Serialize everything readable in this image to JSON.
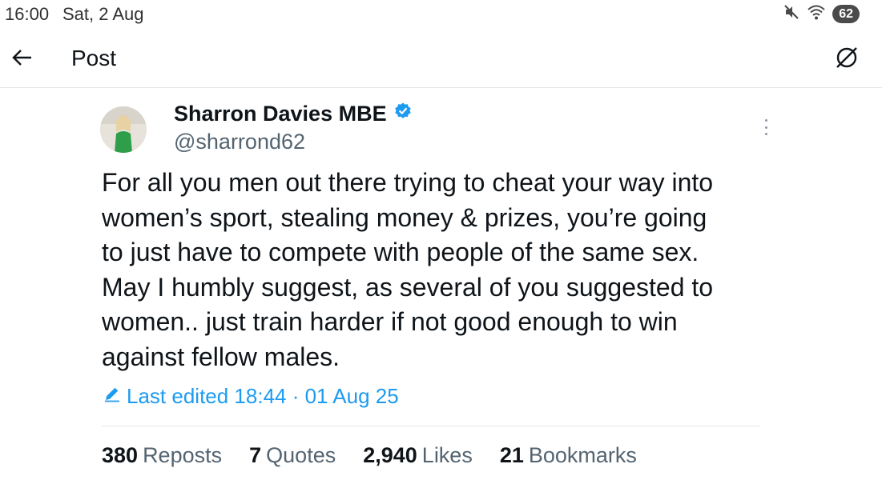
{
  "status_bar": {
    "time": "16:00",
    "date": "Sat, 2 Aug",
    "icons": [
      "mute-icon",
      "wifi-icon"
    ],
    "battery": "62"
  },
  "header": {
    "title": "Post",
    "back_icon": "arrow-left-icon",
    "grok_icon": "grok-icon"
  },
  "post": {
    "author_name": "Sharron Davies MBE",
    "verified": true,
    "handle": "@sharrond62",
    "text": "For all you men out there trying to cheat your way into\nwomen’s sport, stealing money & prizes, you’re going\nto just have to compete with people of the same sex.\nMay I humbly suggest, as several of you suggested to\nwomen..  just train harder if not good enough to win\nagainst fellow males.",
    "edited_label": "Last edited 18:44 · 01 Aug 25"
  },
  "stats": [
    {
      "count": "380",
      "label": "Reposts"
    },
    {
      "count": "7",
      "label": "Quotes"
    },
    {
      "count": "2,940",
      "label": "Likes"
    },
    {
      "count": "21",
      "label": "Bookmarks"
    }
  ],
  "colors": {
    "accent": "#1d9bf0",
    "text": "#0f1419",
    "secondary": "#536471"
  }
}
